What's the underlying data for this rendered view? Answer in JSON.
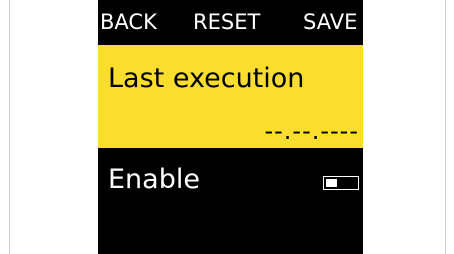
{
  "topbar": {
    "back_label": "BACK",
    "reset_label": "RESET",
    "save_label": "SAVE"
  },
  "last_execution": {
    "title": "Last execution",
    "value": "--.--.----"
  },
  "enable": {
    "label": "Enable",
    "toggle_state": "off"
  },
  "colors": {
    "screen_bg": "#000000",
    "highlight": "#fbde2d",
    "text_light": "#ffffff",
    "text_dark": "#000000"
  }
}
